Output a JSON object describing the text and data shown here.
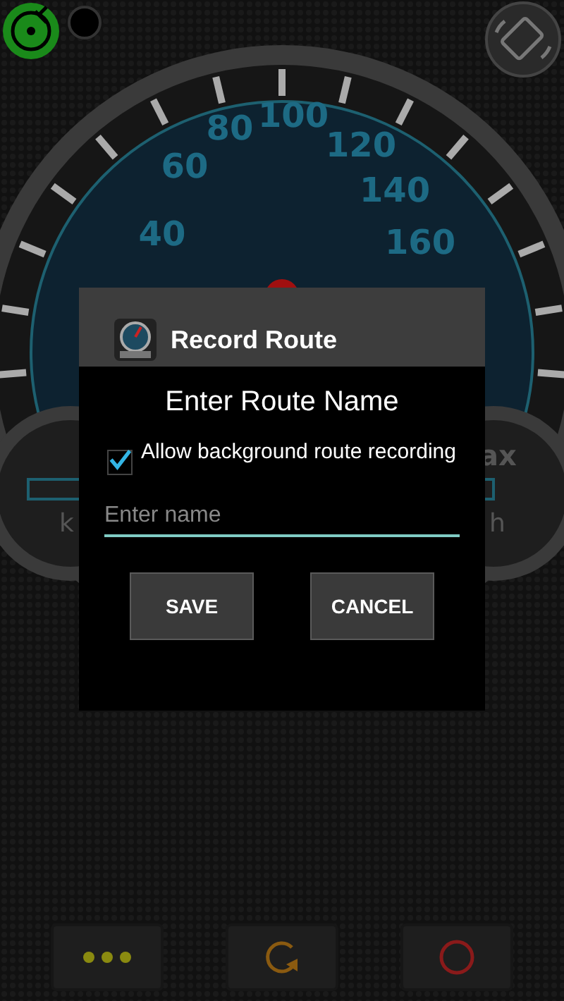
{
  "top_bar": {
    "gps_active": true
  },
  "gauge": {
    "scale_labels": [
      "40",
      "60",
      "80",
      "100",
      "120",
      "140",
      "160"
    ],
    "left_dial": {
      "unit": "k"
    },
    "right_dial": {
      "label": "ax",
      "unit": "h"
    }
  },
  "dialog": {
    "title": "Record Route",
    "heading": "Enter Route Name",
    "checkbox": {
      "label": "Allow background route recording",
      "checked": true
    },
    "field": {
      "placeholder": "Enter name"
    },
    "buttons": [
      "SAVE",
      "CANCEL"
    ]
  },
  "bottom_buttons": [
    {
      "kind": "more"
    },
    {
      "kind": "refresh"
    },
    {
      "kind": "record"
    }
  ]
}
